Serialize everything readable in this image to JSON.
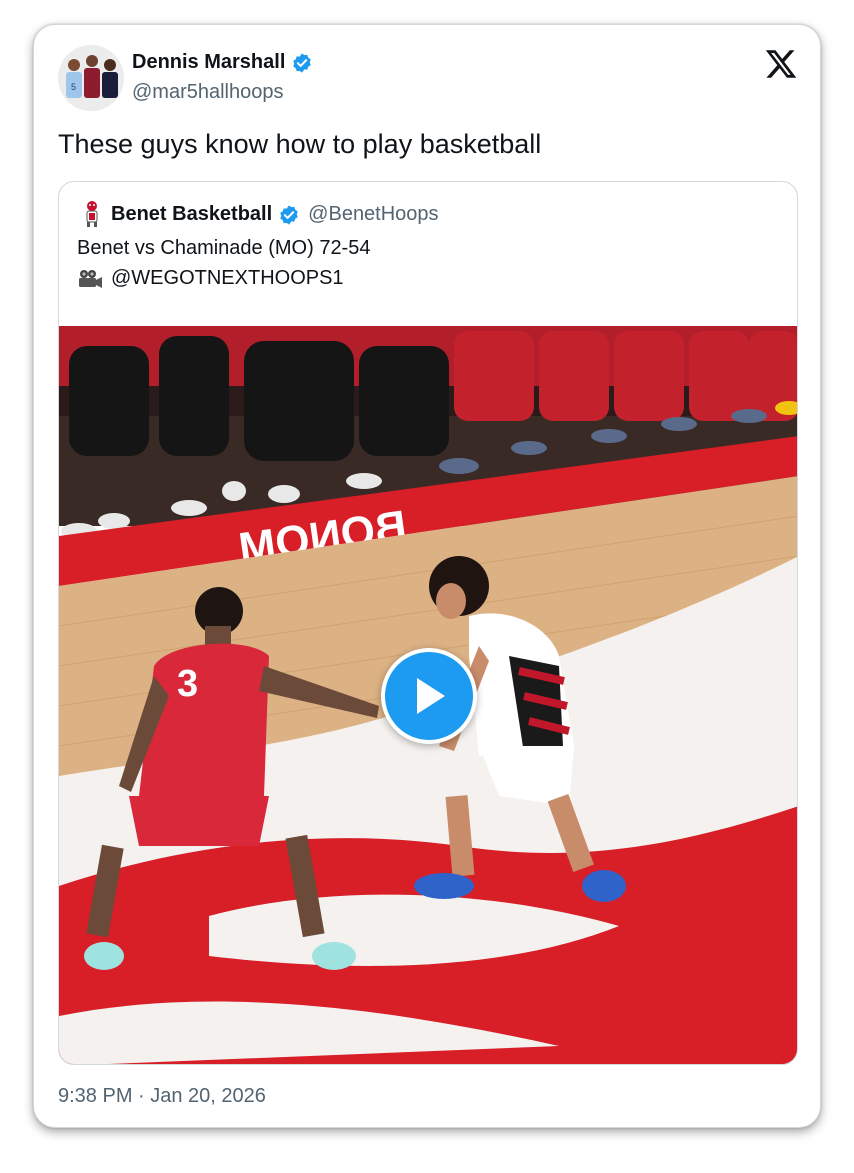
{
  "tweet": {
    "author": {
      "name": "Dennis Marshall",
      "handle": "@mar5hallhoops",
      "verified": true,
      "avatar_icon": "profile-photo"
    },
    "text": "These guys know how to play basketball",
    "timestamp": "9:38 PM · Jan 20, 2026",
    "platform_icon": "x-logo-icon"
  },
  "quoted": {
    "author": {
      "name": "Benet Basketball",
      "handle": "@BenetHoops",
      "verified": true,
      "avatar_icon": "team-logo"
    },
    "line1": "Benet vs Chaminade (MO) 72-54",
    "line2_icon": "movie-camera-icon",
    "line2": "@WEGOTNEXTHOOPS1",
    "media": {
      "type": "video",
      "play_icon": "play-icon",
      "player_number": "3"
    }
  },
  "colors": {
    "verified": "#1d9bf0",
    "text": "#0f1419",
    "secondary": "#536471",
    "border": "#cfd9de",
    "court_red": "#d81e27",
    "court_wood": "#dcb184"
  }
}
